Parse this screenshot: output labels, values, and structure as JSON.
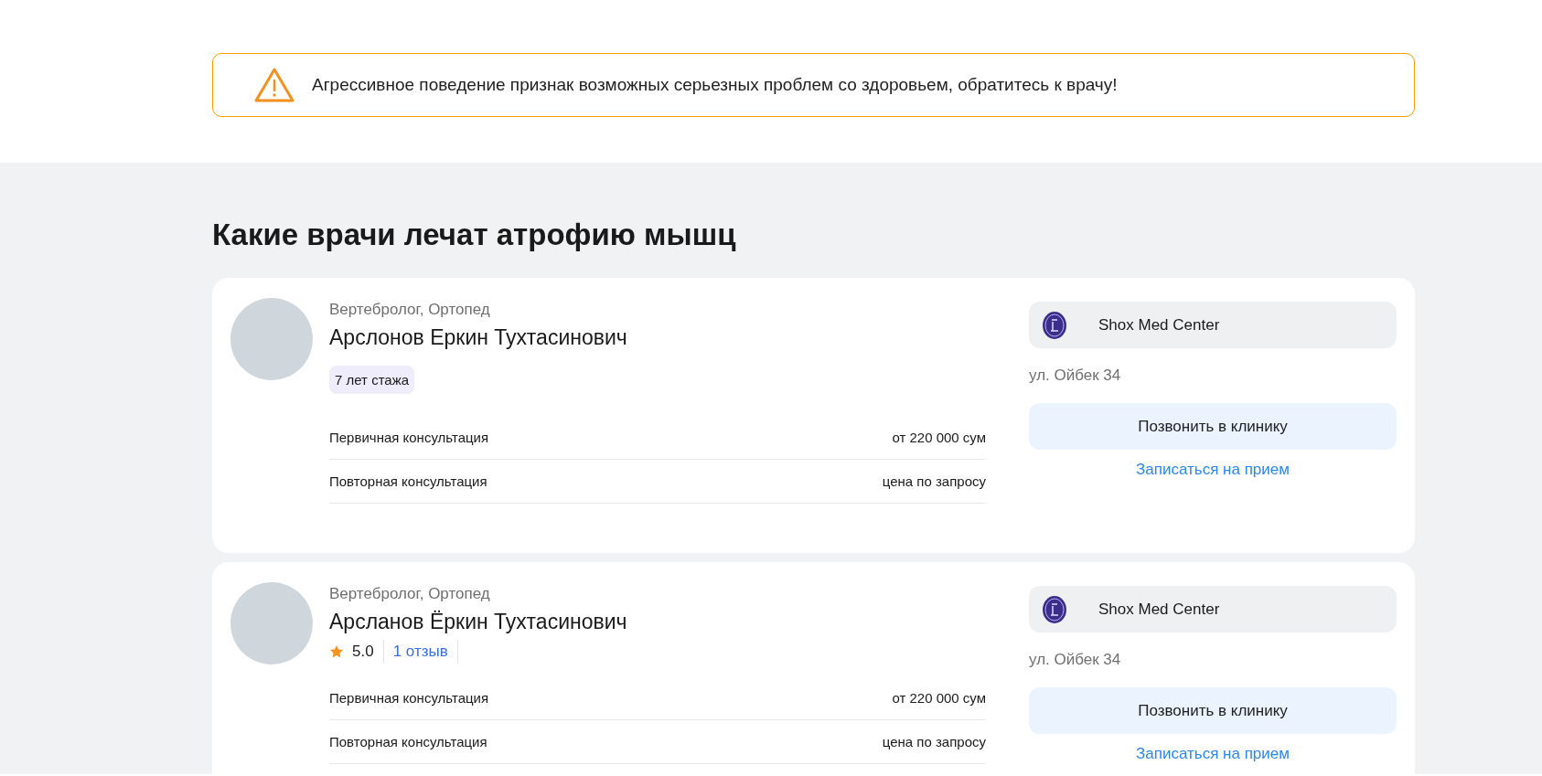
{
  "alert": {
    "text": "Агрессивное поведение признак возможных серьезных проблем со здоровьем, обратитесь к врачу!"
  },
  "doctors_section": {
    "title": "Какие врачи лечат атрофию мышц",
    "doctors": [
      {
        "specialties": "Вертебролог, Ортопед",
        "name": "Арслонов Еркин Тухтасинович",
        "experience": "7 лет стажа",
        "prices": [
          {
            "service": "Первичная консультация",
            "price": "от 220 000 сум"
          },
          {
            "service": "Повторная консультация",
            "price": "цена по запросу"
          }
        ],
        "clinic": "Shox Med Center",
        "address": "ул. Ойбек 34",
        "call_button": "Позвонить в клинику",
        "book_link": "Записаться на прием"
      },
      {
        "specialties": "Вертебролог, Ортопед",
        "name": "Арсланов Ёркин Тухтасинович",
        "rating": "5.0",
        "reviews": "1 отзыв",
        "prices": [
          {
            "service": "Первичная консультация",
            "price": "от 220 000 сум"
          },
          {
            "service": "Повторная консультация",
            "price": "цена по запросу"
          }
        ],
        "clinic": "Shox Med Center",
        "address": "ул. Ойбек 34",
        "call_button": "Позвонить в клинику",
        "book_link": "Записаться на прием"
      }
    ]
  }
}
